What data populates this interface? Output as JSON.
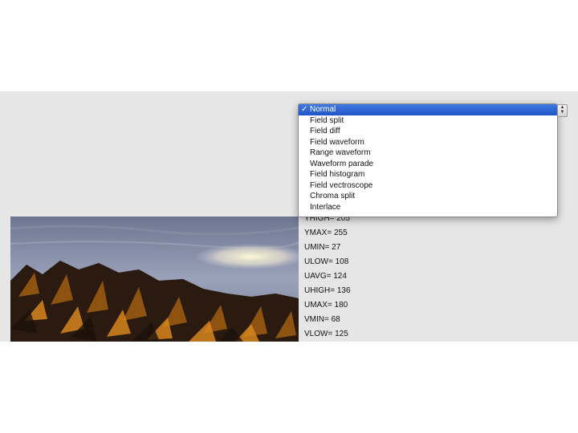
{
  "display_mode_menu": {
    "selected_index": 0,
    "check_mark": "✓",
    "options": [
      "Normal",
      "Field split",
      "Field diff",
      "Field waveform",
      "Range waveform",
      "Waveform parade",
      "Field histogram",
      "Field vectroscope",
      "Chroma split",
      "Interlace"
    ]
  },
  "stats": {
    "lines": [
      "YHIGH= 205",
      "YMAX= 255",
      "UMIN= 27",
      "ULOW= 108",
      "UAVG= 124",
      "UHIGH= 136",
      "UMAX= 180",
      "VMIN= 68",
      "VLOW= 125"
    ]
  },
  "colors": {
    "panel_background": "#e6e6e6",
    "selection_highlight": "#2d62d6"
  },
  "icons": {
    "stepper": "up-down-arrows-icon",
    "check": "checkmark-icon"
  }
}
